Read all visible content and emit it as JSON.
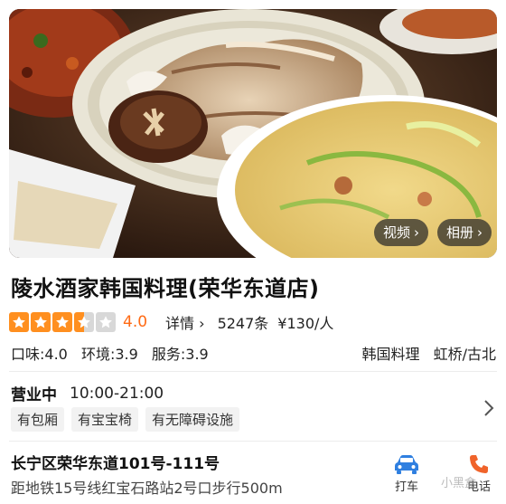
{
  "hero": {
    "video_label": "视频",
    "album_label": "相册"
  },
  "shop": {
    "name": "陵水酒家韩国料理(荣华东道店)",
    "rating": 3.5,
    "score_text": "4.0",
    "detail_label": "详情",
    "reviews": "5247条",
    "price": "¥130/人",
    "taste": "口味:4.0",
    "environment": "环境:3.9",
    "service": "服务:3.9",
    "category": "韩国料理",
    "area": "虹桥/古北"
  },
  "hours": {
    "status": "营业中",
    "time": "10:00-21:00"
  },
  "tags": [
    "有包厢",
    "有宝宝椅",
    "有无障碍设施"
  ],
  "address": {
    "street": "长宁区荣华东道101号-111号",
    "distance": "距地铁15号线红宝石路站2号口步行500m"
  },
  "actions": {
    "taxi_label": "打车",
    "phone_label": "电话"
  },
  "watermark": "小黑盒",
  "colors": {
    "star": "#ff8f1f",
    "score": "#ff6a14",
    "taxi_icon": "#2f7fe0",
    "phone_icon": "#f0632a"
  }
}
